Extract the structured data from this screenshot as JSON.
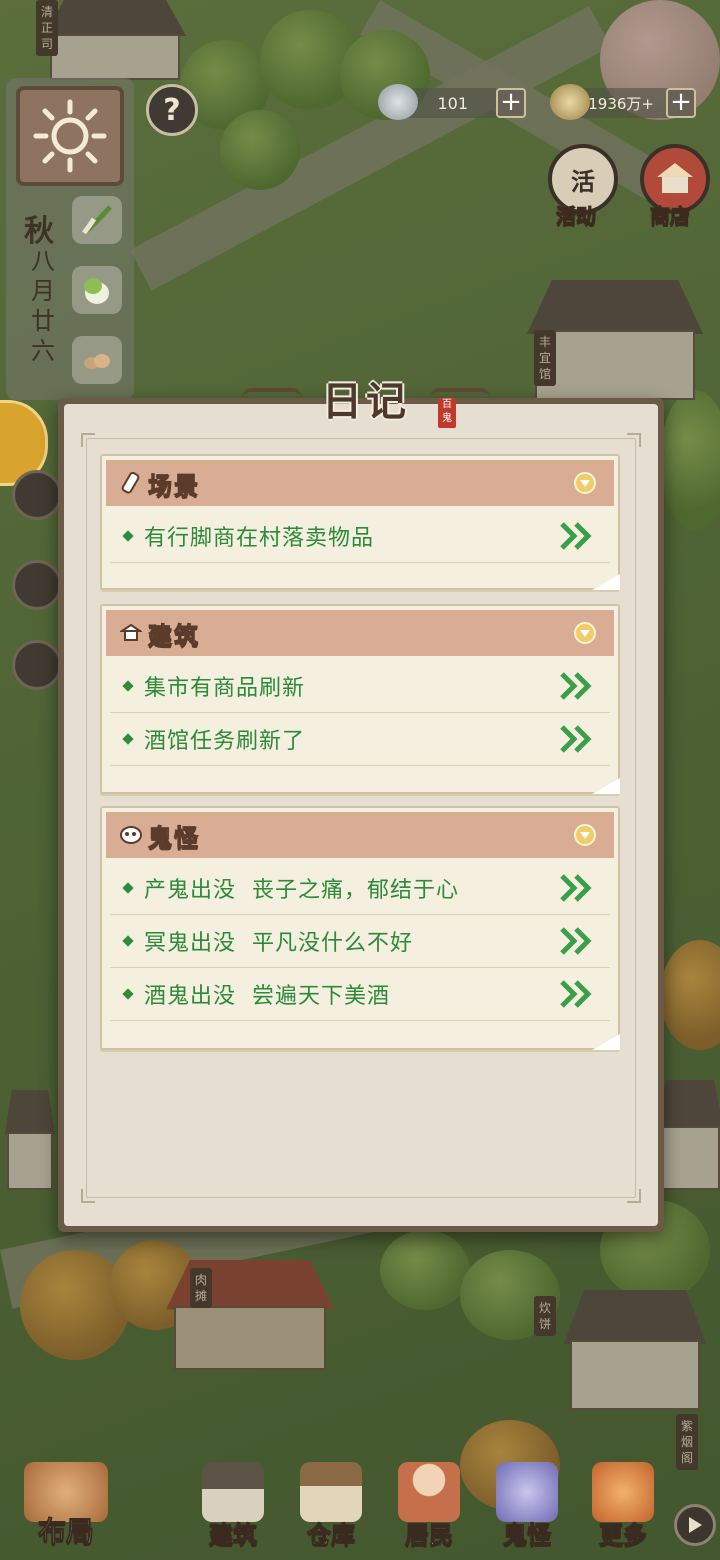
{
  "hud": {
    "season": "秋",
    "date": [
      "八",
      "月",
      "廿",
      "六"
    ],
    "help_symbol": "?",
    "silver": "101",
    "copper": "1936万+",
    "plus_symbol": "+",
    "activity_label": "活动",
    "shop_label": "商店",
    "activity_icon_char": "活"
  },
  "map_signs": {
    "top_left": "清正司",
    "tavern": "丰宜馆",
    "meat_stall": "肉摊",
    "bakery": "炊饼",
    "right_bottom": "紫烟阁"
  },
  "diary": {
    "title": "日记",
    "seal_text": "百鬼",
    "sections": [
      {
        "title": "场景",
        "icon": "scroll-icon",
        "entries": [
          "有行脚商在村落卖物品"
        ]
      },
      {
        "title": "建筑",
        "icon": "building-icon",
        "entries": [
          "集市有商品刷新",
          "酒馆任务刷新了"
        ]
      },
      {
        "title": "鬼怪",
        "icon": "ghost-icon",
        "entries": [
          "产鬼出没  丧子之痛，郁结于心",
          "冥鬼出没  平凡没什么不好",
          "酒鬼出没  尝遍天下美酒"
        ]
      }
    ]
  },
  "nav": {
    "layout": "布局",
    "build": "建筑",
    "storage": "仓库",
    "residents": "居民",
    "ghosts": "鬼怪",
    "more": "更多"
  },
  "colors": {
    "entry_text": "#2c8a3a",
    "section_header": "#d9ad94",
    "panel_bg": "#e6ded0",
    "modal_border": "#6b5a46"
  }
}
